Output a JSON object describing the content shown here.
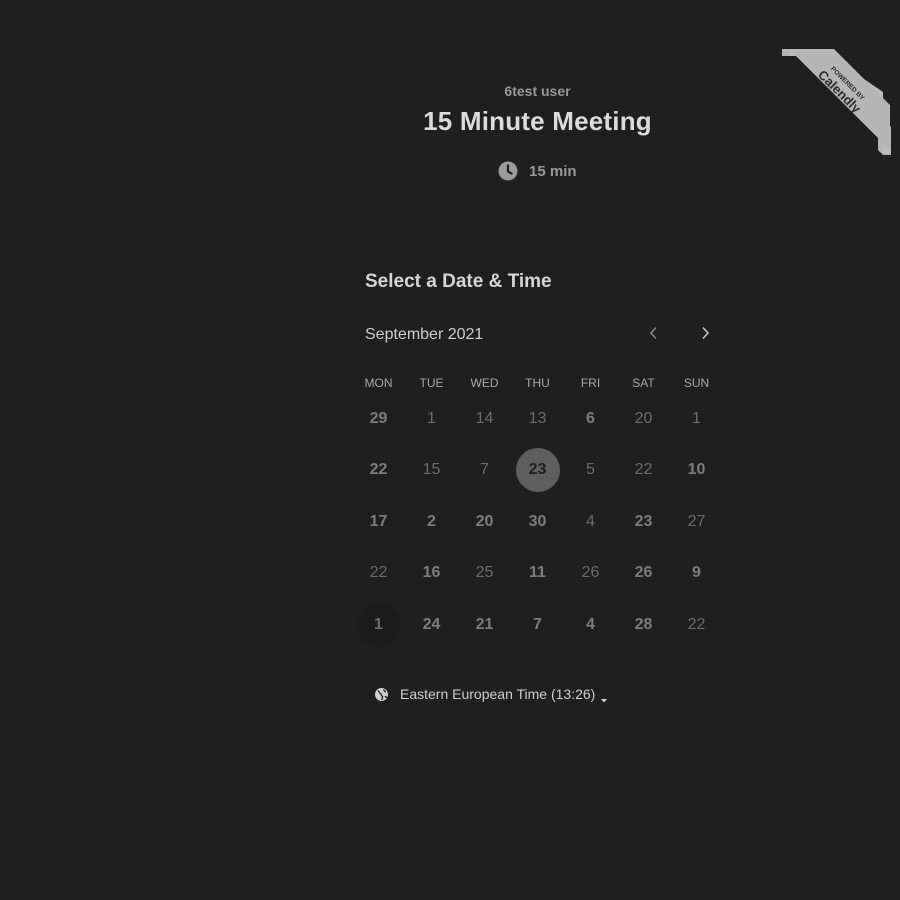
{
  "host": {
    "name": "6test user"
  },
  "event": {
    "title": "15 Minute Meeting",
    "duration": "15 min",
    "duration_icon": "clock-icon"
  },
  "badge": {
    "line1": "POWERED BY",
    "line2": "Calendly"
  },
  "scheduler": {
    "title": "Select a Date & Time",
    "month": "September 2021",
    "prev_icon": "chevron-left-icon",
    "next_icon": "chevron-right-icon",
    "weekdays": [
      "MON",
      "TUE",
      "WED",
      "THU",
      "FRI",
      "SAT",
      "SUN"
    ],
    "weeks": [
      [
        {
          "d": "29",
          "b": true
        },
        {
          "d": "1"
        },
        {
          "d": "14"
        },
        {
          "d": "13"
        },
        {
          "d": "6",
          "b": true
        },
        {
          "d": "20"
        },
        {
          "d": "1"
        }
      ],
      [
        {
          "d": "22",
          "b": true
        },
        {
          "d": "15"
        },
        {
          "d": "7"
        },
        {
          "d": "23",
          "b": true,
          "selected": true
        },
        {
          "d": "5"
        },
        {
          "d": "22"
        },
        {
          "d": "10",
          "b": true
        }
      ],
      [
        {
          "d": "17",
          "b": true
        },
        {
          "d": "2",
          "b": true
        },
        {
          "d": "20",
          "b": true
        },
        {
          "d": "30",
          "b": true
        },
        {
          "d": "4"
        },
        {
          "d": "23",
          "b": true
        },
        {
          "d": "27"
        }
      ],
      [
        {
          "d": "22"
        },
        {
          "d": "16",
          "b": true
        },
        {
          "d": "25"
        },
        {
          "d": "11",
          "b": true
        },
        {
          "d": "26"
        },
        {
          "d": "26",
          "b": true
        },
        {
          "d": "9",
          "b": true
        }
      ],
      [
        {
          "d": "1",
          "b": true,
          "today": true
        },
        {
          "d": "24",
          "b": true
        },
        {
          "d": "21",
          "b": true
        },
        {
          "d": "7",
          "b": true
        },
        {
          "d": "4",
          "b": true
        },
        {
          "d": "28",
          "b": true
        },
        {
          "d": "22"
        }
      ]
    ]
  },
  "timezone": {
    "label": "Eastern European Time (13:26)",
    "icon": "globe-icon"
  },
  "colors": {
    "background": "#1f1f1f",
    "selected_day": "#5f5f5f",
    "ribbon": "#b4b4b4"
  }
}
